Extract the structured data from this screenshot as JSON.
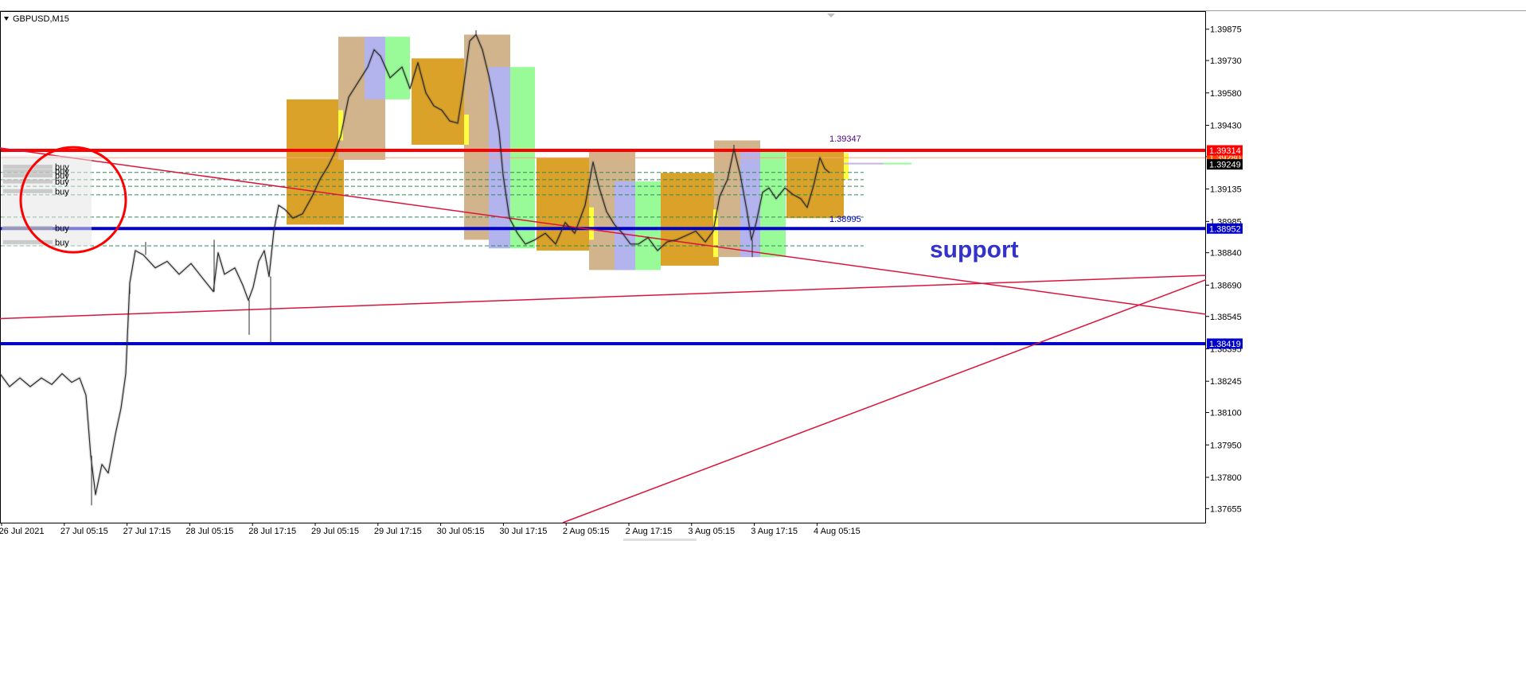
{
  "chart_data": {
    "type": "candlestick",
    "symbol_label": "GBPUSD,M15",
    "y_range": [
      1.3759,
      1.39955
    ],
    "y_ticks": [
      "1.39875",
      "1.39730",
      "1.39580",
      "1.39430",
      "1.39285",
      "1.39135",
      "1.38985",
      "1.38840",
      "1.38690",
      "1.38545",
      "1.38395",
      "1.38245",
      "1.38100",
      "1.37950",
      "1.37800",
      "1.37655"
    ],
    "x_ticks": [
      "26 Jul 2021",
      "27 Jul 05:15",
      "27 Jul 17:15",
      "28 Jul 05:15",
      "28 Jul 17:15",
      "29 Jul 05:15",
      "29 Jul 17:15",
      "30 Jul 05:15",
      "30 Jul 17:15",
      "2 Aug 05:15",
      "2 Aug 17:15",
      "3 Aug 05:15",
      "3 Aug 17:15",
      "4 Aug 05:15"
    ],
    "price_series": [
      [
        0,
        1.3828
      ],
      [
        12,
        1.3822
      ],
      [
        25,
        1.3826
      ],
      [
        38,
        1.3822
      ],
      [
        52,
        1.3826
      ],
      [
        65,
        1.3823
      ],
      [
        78,
        1.3828
      ],
      [
        90,
        1.3824
      ],
      [
        100,
        1.3826
      ],
      [
        108,
        1.3818
      ],
      [
        114,
        1.379
      ],
      [
        120,
        1.3772
      ],
      [
        128,
        1.3786
      ],
      [
        136,
        1.3782
      ],
      [
        145,
        1.38
      ],
      [
        152,
        1.3812
      ],
      [
        158,
        1.3828
      ],
      [
        163,
        1.387
      ],
      [
        170,
        1.3885
      ],
      [
        180,
        1.3883
      ],
      [
        195,
        1.3877
      ],
      [
        210,
        1.388
      ],
      [
        225,
        1.3874
      ],
      [
        240,
        1.3879
      ],
      [
        255,
        1.3872
      ],
      [
        268,
        1.3866
      ],
      [
        274,
        1.3884
      ],
      [
        282,
        1.3874
      ],
      [
        295,
        1.3877
      ],
      [
        305,
        1.3869
      ],
      [
        312,
        1.3862
      ],
      [
        318,
        1.3868
      ],
      [
        325,
        1.388
      ],
      [
        332,
        1.3885
      ],
      [
        338,
        1.3873
      ],
      [
        344,
        1.3894
      ],
      [
        350,
        1.3906
      ],
      [
        358,
        1.3904
      ],
      [
        368,
        1.39
      ],
      [
        380,
        1.3902
      ],
      [
        392,
        1.391
      ],
      [
        402,
        1.3918
      ],
      [
        412,
        1.3924
      ],
      [
        420,
        1.393
      ],
      [
        428,
        1.3938
      ],
      [
        438,
        1.3956
      ],
      [
        450,
        1.3963
      ],
      [
        462,
        1.397
      ],
      [
        470,
        1.3978
      ],
      [
        478,
        1.3975
      ],
      [
        490,
        1.3965
      ],
      [
        505,
        1.397
      ],
      [
        515,
        1.396
      ],
      [
        525,
        1.3972
      ],
      [
        535,
        1.3958
      ],
      [
        545,
        1.3952
      ],
      [
        555,
        1.395
      ],
      [
        565,
        1.3945
      ],
      [
        575,
        1.3944
      ],
      [
        582,
        1.396
      ],
      [
        590,
        1.3982
      ],
      [
        598,
        1.3985
      ],
      [
        606,
        1.3978
      ],
      [
        614,
        1.3966
      ],
      [
        620,
        1.3955
      ],
      [
        627,
        1.394
      ],
      [
        632,
        1.392
      ],
      [
        640,
        1.39
      ],
      [
        650,
        1.3893
      ],
      [
        660,
        1.3888
      ],
      [
        672,
        1.389
      ],
      [
        685,
        1.3893
      ],
      [
        698,
        1.3888
      ],
      [
        710,
        1.3898
      ],
      [
        722,
        1.3893
      ],
      [
        735,
        1.3906
      ],
      [
        745,
        1.3926
      ],
      [
        752,
        1.3915
      ],
      [
        762,
        1.3903
      ],
      [
        772,
        1.3897
      ],
      [
        782,
        1.3893
      ],
      [
        792,
        1.3888
      ],
      [
        802,
        1.3888
      ],
      [
        814,
        1.3891
      ],
      [
        826,
        1.3885
      ],
      [
        838,
        1.3889
      ],
      [
        850,
        1.389
      ],
      [
        862,
        1.3892
      ],
      [
        874,
        1.3894
      ],
      [
        886,
        1.3889
      ],
      [
        896,
        1.3894
      ],
      [
        904,
        1.391
      ],
      [
        914,
        1.3918
      ],
      [
        922,
        1.3932
      ],
      [
        930,
        1.392
      ],
      [
        938,
        1.3904
      ],
      [
        944,
        1.389
      ],
      [
        950,
        1.3898
      ],
      [
        958,
        1.3912
      ],
      [
        966,
        1.3914
      ],
      [
        975,
        1.3909
      ],
      [
        986,
        1.3914
      ],
      [
        996,
        1.3911
      ],
      [
        1006,
        1.3909
      ],
      [
        1014,
        1.3905
      ],
      [
        1022,
        1.3915
      ],
      [
        1030,
        1.3928
      ],
      [
        1036,
        1.3923
      ],
      [
        1042,
        1.3921
      ]
    ],
    "zones": [
      {
        "x0": 360,
        "x1": 432,
        "y0": 1.3955,
        "y1": 1.3897,
        "color": "#dba22a"
      },
      {
        "x0": 425,
        "x1": 484,
        "y0": 1.3984,
        "y1": 1.3927,
        "color": "#d2b48c"
      },
      {
        "x0": 458,
        "x1": 484,
        "y0": 1.3984,
        "y1": 1.3955,
        "color": "#b3b3ee"
      },
      {
        "x0": 484,
        "x1": 515,
        "y0": 1.3984,
        "y1": 1.3955,
        "color": "#98fb98"
      },
      {
        "x0": 517,
        "x1": 583,
        "y0": 1.3974,
        "y1": 1.3934,
        "color": "#dba22a"
      },
      {
        "x0": 583,
        "x1": 641,
        "y0": 1.3985,
        "y1": 1.389,
        "color": "#d2b48c"
      },
      {
        "x0": 614,
        "x1": 641,
        "y0": 1.397,
        "y1": 1.3886,
        "color": "#b3b3ee"
      },
      {
        "x0": 641,
        "x1": 672,
        "y0": 1.397,
        "y1": 1.3886,
        "color": "#98fb98"
      },
      {
        "x0": 674,
        "x1": 740,
        "y0": 1.3928,
        "y1": 1.3885,
        "color": "#dba22a"
      },
      {
        "x0": 740,
        "x1": 798,
        "y0": 1.3932,
        "y1": 1.3876,
        "color": "#d2b48c"
      },
      {
        "x0": 772,
        "x1": 798,
        "y0": 1.3917,
        "y1": 1.3876,
        "color": "#b3b3ee"
      },
      {
        "x0": 798,
        "x1": 830,
        "y0": 1.3917,
        "y1": 1.3876,
        "color": "#98fb98"
      },
      {
        "x0": 830,
        "x1": 903,
        "y0": 1.3921,
        "y1": 1.3878,
        "color": "#dba22a"
      },
      {
        "x0": 897,
        "x1": 955,
        "y0": 1.3936,
        "y1": 1.3882,
        "color": "#d2b48c"
      },
      {
        "x0": 930,
        "x1": 955,
        "y0": 1.3932,
        "y1": 1.3882,
        "color": "#b3b3ee"
      },
      {
        "x0": 955,
        "x1": 987,
        "y0": 1.3932,
        "y1": 1.3882,
        "color": "#98fb98"
      },
      {
        "x0": 988,
        "x1": 1060,
        "y0": 1.3931,
        "y1": 1.39,
        "color": "#dba22a"
      }
    ],
    "trend_lines": [
      {
        "x0": 0,
        "y0": 1.39325,
        "x1": 1515,
        "y1": 1.38555,
        "color": "#dc143c"
      },
      {
        "x0": 0,
        "y0": 1.38535,
        "x1": 1515,
        "y1": 1.38735,
        "color": "#dc143c"
      },
      {
        "x0": 707,
        "y0": 1.3759,
        "x1": 1515,
        "y1": 1.38715,
        "color": "#dc143c"
      }
    ],
    "levels": [
      {
        "price": 1.39314,
        "label": "1.39314",
        "color": "#ff0000"
      },
      {
        "price": 1.38952,
        "label": "1.38952",
        "color": "#0000cc"
      },
      {
        "price": 1.38419,
        "label": "1.38419",
        "color": "#0000cc"
      }
    ],
    "hidden_tag": {
      "price": 1.3928,
      "label": "1.39280",
      "color": "#ff4500"
    },
    "current_price": {
      "price": 1.39249,
      "label": "1.39249",
      "color": "#000000"
    },
    "dashed_levels": [
      1.39212,
      1.39178,
      1.39148,
      1.39108,
      1.39005,
      1.38872
    ],
    "line_value_labels": [
      {
        "label": "1.39347",
        "price": 1.39347,
        "x": 1042,
        "color": "#4b0082"
      },
      {
        "label": "1.38995",
        "price": 1.38975,
        "x": 1042,
        "color": "#0000cc"
      }
    ],
    "buy_labels": [
      {
        "price": 1.39238,
        "label": "buy"
      },
      {
        "price": 1.39218,
        "label": "buy"
      },
      {
        "price": 1.39198,
        "label": "buy"
      },
      {
        "price": 1.3917,
        "label": "buy"
      },
      {
        "price": 1.39125,
        "label": "buy"
      },
      {
        "price": 1.38955,
        "label": "buy"
      },
      {
        "price": 1.38889,
        "label": "buy"
      }
    ],
    "annotation": {
      "text": "support",
      "price": 1.38855,
      "x": 1168,
      "color": "#3333cc"
    },
    "circle": {
      "x": 92,
      "price": 1.39085,
      "r": 66,
      "color": "#ff0000"
    }
  }
}
